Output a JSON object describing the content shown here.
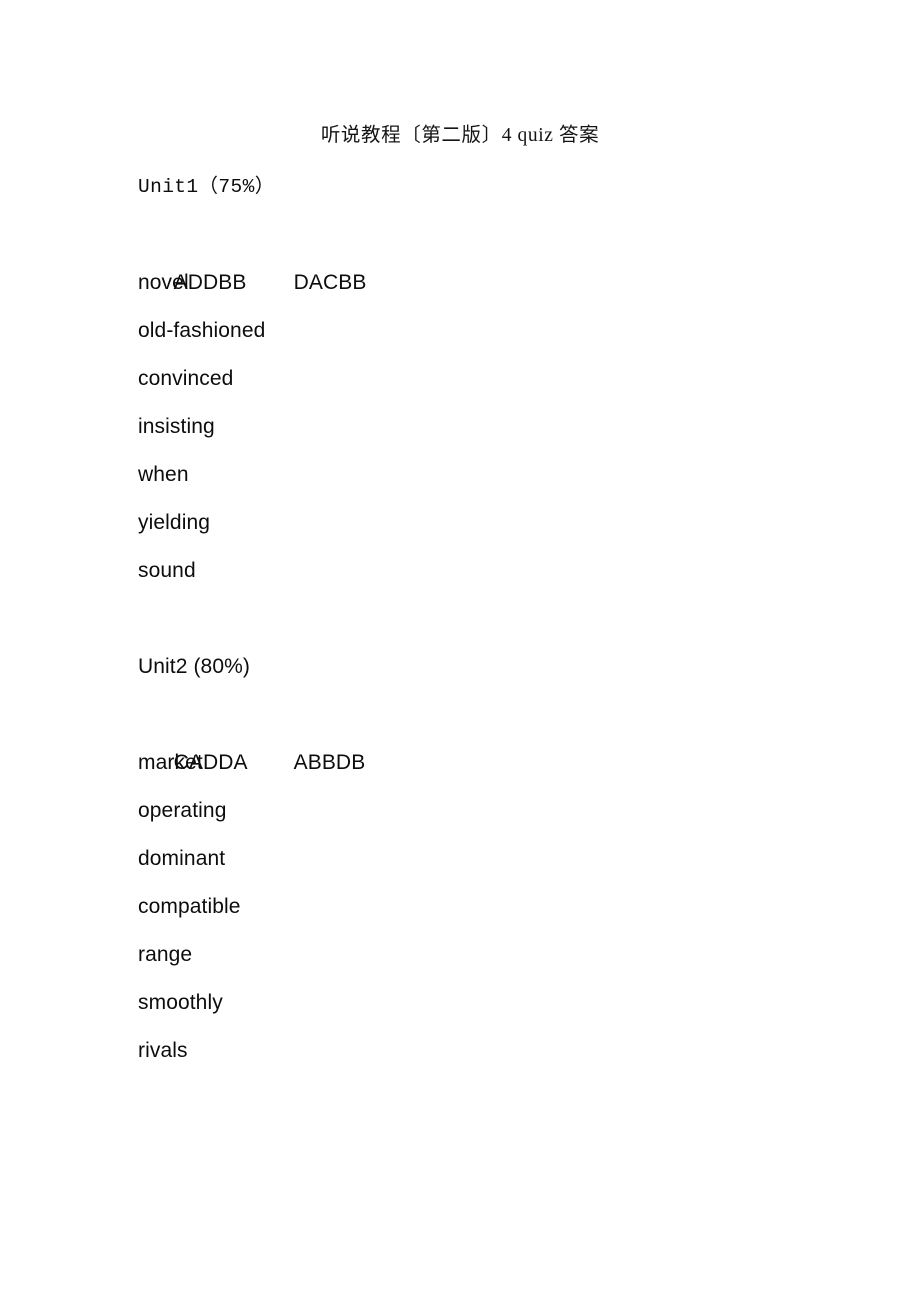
{
  "document": {
    "title": "听说教程〔第二版〕4 quiz 答案"
  },
  "units": [
    {
      "heading": "Unit1（75%）",
      "answers": {
        "column1": "ADDBB",
        "column2": "DACBB"
      },
      "words": [
        "novel",
        "old-fashioned",
        "convinced",
        "insisting",
        "when",
        "yielding",
        "sound"
      ]
    },
    {
      "heading": "Unit2 (80%)",
      "answers": {
        "column1": "CADDA",
        "column2": "ABBDB"
      },
      "words": [
        "market",
        "operating",
        "dominant",
        "compatible",
        "range",
        "smoothly",
        "rivals"
      ]
    }
  ]
}
